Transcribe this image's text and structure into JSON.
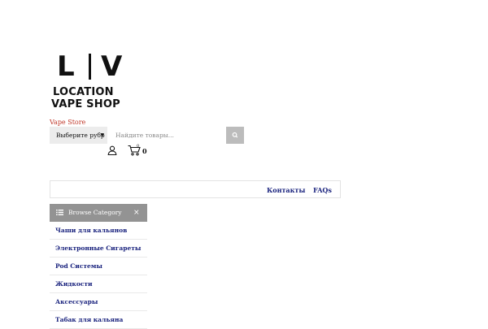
{
  "logo": {
    "top_left": "L",
    "top_right": "V",
    "line1": "LOCATION",
    "line2": "VAPE SHOP"
  },
  "tagline": "Vape Store",
  "search": {
    "category_label": "Выберите рубр",
    "placeholder": "Найдите товары..."
  },
  "header": {
    "cart_count": "0",
    "cart_badge": "0"
  },
  "nav": {
    "links": [
      "Контакты",
      "FAQs"
    ]
  },
  "browse": {
    "label": "Browse Category",
    "close": "×"
  },
  "categories": [
    "Чаши для кальянов",
    "Электронные Сигареты",
    "Pod Системы",
    "Жидкости",
    "Аксессуары",
    "Табак для кальяна"
  ],
  "colors": {
    "tagline": "#c0392b",
    "link": "#1a237e",
    "browse_bg": "#939393"
  },
  "icons": [
    "user-icon",
    "cart-icon",
    "search-icon",
    "list-icon",
    "close-icon",
    "chevron-down-icon"
  ]
}
